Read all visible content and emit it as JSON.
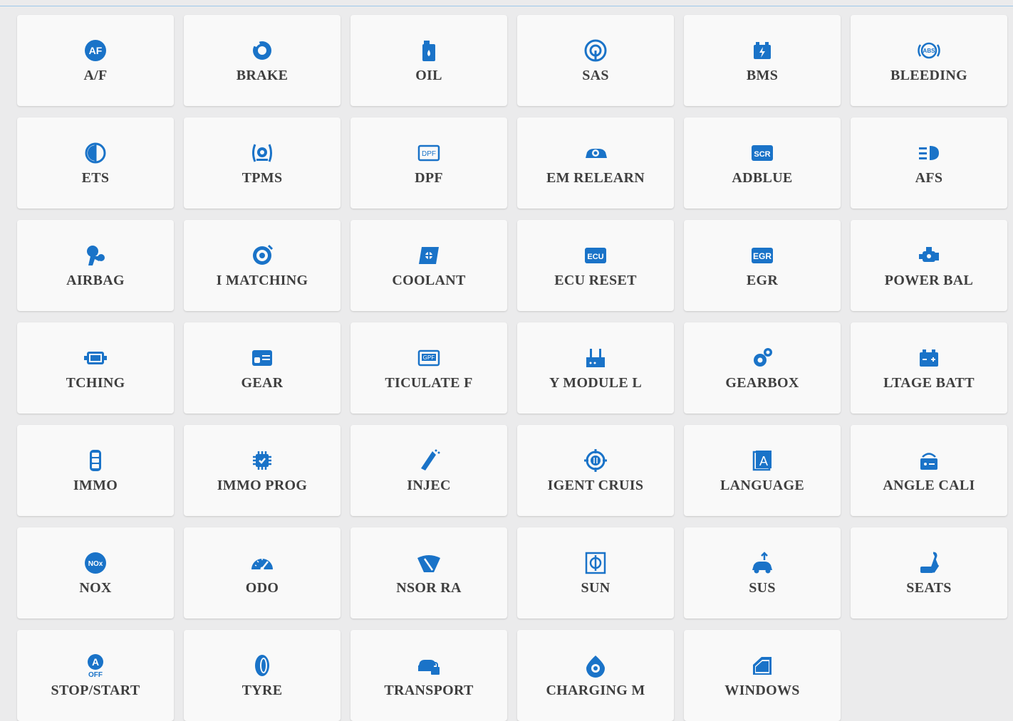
{
  "accent_color": "#1a73c8",
  "tiles": [
    {
      "label": "A/F",
      "icon": "af-icon"
    },
    {
      "label": "BRAKE",
      "icon": "brake-icon"
    },
    {
      "label": "OIL",
      "icon": "oil-icon"
    },
    {
      "label": "SAS",
      "icon": "steering-angle-icon"
    },
    {
      "label": "BMS",
      "icon": "battery-icon"
    },
    {
      "label": "BLEEDING",
      "icon": "abs-icon"
    },
    {
      "label": "ETS",
      "icon": "throttle-icon"
    },
    {
      "label": "TPMS",
      "icon": "tire-pressure-icon"
    },
    {
      "label": "DPF",
      "icon": "dpf-icon"
    },
    {
      "label": "EM RELEARN",
      "icon": "car-relearn-icon"
    },
    {
      "label": "ADBLUE",
      "icon": "scr-icon"
    },
    {
      "label": "AFS",
      "icon": "headlight-icon"
    },
    {
      "label": "AIRBAG",
      "icon": "airbag-icon"
    },
    {
      "label": "I MATCHING",
      "icon": "injector-matching-icon"
    },
    {
      "label": "COOLANT",
      "icon": "coolant-icon"
    },
    {
      "label": "ECU RESET",
      "icon": "ecu-icon"
    },
    {
      "label": "EGR",
      "icon": "egr-icon"
    },
    {
      "label": "POWER BAL",
      "icon": "engine-icon"
    },
    {
      "label": "TCHING",
      "icon": "module-icon"
    },
    {
      "label": "GEAR",
      "icon": "gear-learn-icon"
    },
    {
      "label": "TICULATE F",
      "icon": "gpf-icon"
    },
    {
      "label": "Y MODULE L",
      "icon": "gateway-module-icon"
    },
    {
      "label": "GEARBOX",
      "icon": "gearbox-icon"
    },
    {
      "label": "LTAGE BATT",
      "icon": "high-voltage-battery-icon"
    },
    {
      "label": "IMMO",
      "icon": "car-key-icon"
    },
    {
      "label": "IMMO PROG",
      "icon": "immo-chip-icon"
    },
    {
      "label": "INJEC",
      "icon": "injector-icon"
    },
    {
      "label": "IGENT CRUIS",
      "icon": "cruise-control-icon"
    },
    {
      "label": "LANGUAGE",
      "icon": "language-icon"
    },
    {
      "label": "ANGLE CALI",
      "icon": "angle-calibration-icon"
    },
    {
      "label": "NOX",
      "icon": "nox-icon"
    },
    {
      "label": "ODO",
      "icon": "odometer-icon"
    },
    {
      "label": "NSOR RA",
      "icon": "wiper-sensor-icon"
    },
    {
      "label": "SUN",
      "icon": "sunroof-icon"
    },
    {
      "label": "SUS",
      "icon": "suspension-icon"
    },
    {
      "label": "SEATS",
      "icon": "seat-icon"
    },
    {
      "label": "STOP/START",
      "icon": "auto-stop-off-icon"
    },
    {
      "label": "TYRE",
      "icon": "tyre-icon"
    },
    {
      "label": "TRANSPORT",
      "icon": "transport-mode-icon"
    },
    {
      "label": "CHARGING M",
      "icon": "turbo-charging-icon"
    },
    {
      "label": "WINDOWS",
      "icon": "window-icon"
    }
  ]
}
